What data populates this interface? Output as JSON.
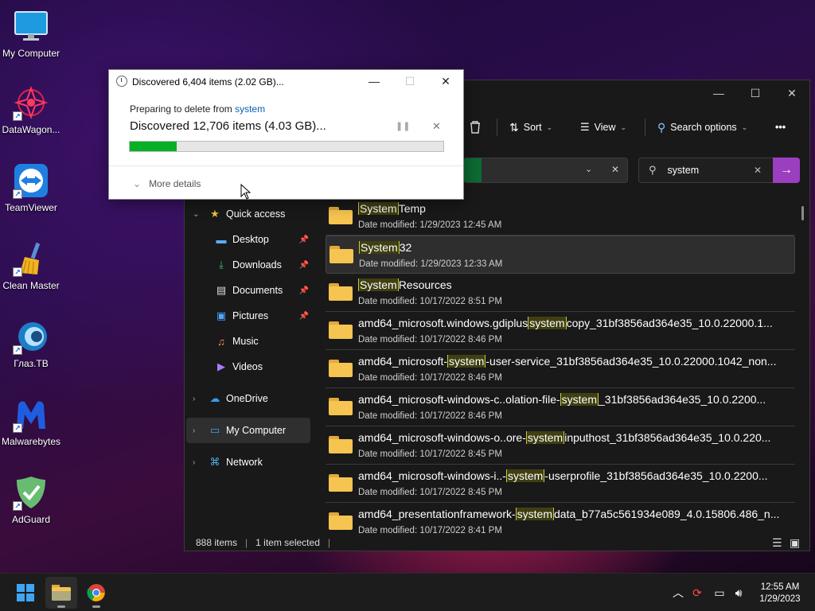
{
  "desktop": {
    "icons": [
      {
        "label": "My Computer",
        "icon": "monitor-icon"
      },
      {
        "label": "DataWagon...",
        "icon": "datawagon-icon"
      },
      {
        "label": "TeamViewer",
        "icon": "teamviewer-icon"
      },
      {
        "label": "Clean Master",
        "icon": "broom-icon"
      },
      {
        "label": "Глаз.ТВ",
        "icon": "glaz-tv-icon"
      },
      {
        "label": "Malwarebytes",
        "icon": "malwarebytes-icon"
      },
      {
        "label": "AdGuard",
        "icon": "adguard-icon"
      }
    ]
  },
  "dialog": {
    "title": "Discovered 6,404 items (2.02 GB)...",
    "preparing_prefix": "Preparing to delete from ",
    "preparing_target": "system",
    "status": "Discovered 12,706 items (4.03 GB)...",
    "progress_percent": 15,
    "more_details": "More details",
    "colors": {
      "progress": "#06b025",
      "link": "#0a5fb4"
    }
  },
  "explorer": {
    "toolbar": {
      "sort": "Sort",
      "view": "View",
      "search_options": "Search options",
      "more": "•••"
    },
    "search": {
      "value": "system"
    },
    "nav": {
      "quick_access": "Quick access",
      "items": [
        {
          "label": "Desktop",
          "pinned": true,
          "icon": "desktop-icon"
        },
        {
          "label": "Downloads",
          "pinned": true,
          "icon": "download-icon"
        },
        {
          "label": "Documents",
          "pinned": true,
          "icon": "document-icon"
        },
        {
          "label": "Pictures",
          "pinned": true,
          "icon": "picture-icon"
        },
        {
          "label": "Music",
          "pinned": false,
          "icon": "music-icon"
        },
        {
          "label": "Videos",
          "pinned": false,
          "icon": "video-icon"
        }
      ],
      "onedrive": "OneDrive",
      "my_computer": "My Computer",
      "network": "Network"
    },
    "files": [
      {
        "pre": "",
        "match": "System",
        "post": "Temp",
        "meta": "Date modified: 1/29/2023 12:45 AM"
      },
      {
        "pre": "",
        "match": "System",
        "post": "32",
        "meta": "Date modified: 1/29/2023 12:33 AM"
      },
      {
        "pre": "",
        "match": "System",
        "post": "Resources",
        "meta": "Date modified: 10/17/2022 8:51 PM"
      },
      {
        "pre": "amd64_microsoft.windows.gdiplus",
        "match": "system",
        "post": "copy_31bf3856ad364e35_10.0.22000.1...",
        "meta": "Date modified: 10/17/2022 8:46 PM"
      },
      {
        "pre": "amd64_microsoft-",
        "match": "system",
        "post": "-user-service_31bf3856ad364e35_10.0.22000.1042_non...",
        "meta": "Date modified: 10/17/2022 8:46 PM"
      },
      {
        "pre": "amd64_microsoft-windows-c..olation-file-",
        "match": "system",
        "post": "_31bf3856ad364e35_10.0.2200...",
        "meta": "Date modified: 10/17/2022 8:46 PM"
      },
      {
        "pre": "amd64_microsoft-windows-o..ore-",
        "match": "system",
        "post": "inputhost_31bf3856ad364e35_10.0.220...",
        "meta": "Date modified: 10/17/2022 8:45 PM"
      },
      {
        "pre": "amd64_microsoft-windows-i..-",
        "match": "system",
        "post": "-userprofile_31bf3856ad364e35_10.0.2200...",
        "meta": "Date modified: 10/17/2022 8:45 PM"
      },
      {
        "pre": "amd64_presentationframework-",
        "match": "system",
        "post": "data_b77a5c561934e089_4.0.15806.486_n...",
        "meta": "Date modified: 10/17/2022 8:41 PM"
      }
    ],
    "status": {
      "items": "888 items",
      "selected": "1 item selected"
    }
  },
  "taskbar": {
    "time": "12:55 AM",
    "date": "1/29/2023"
  }
}
